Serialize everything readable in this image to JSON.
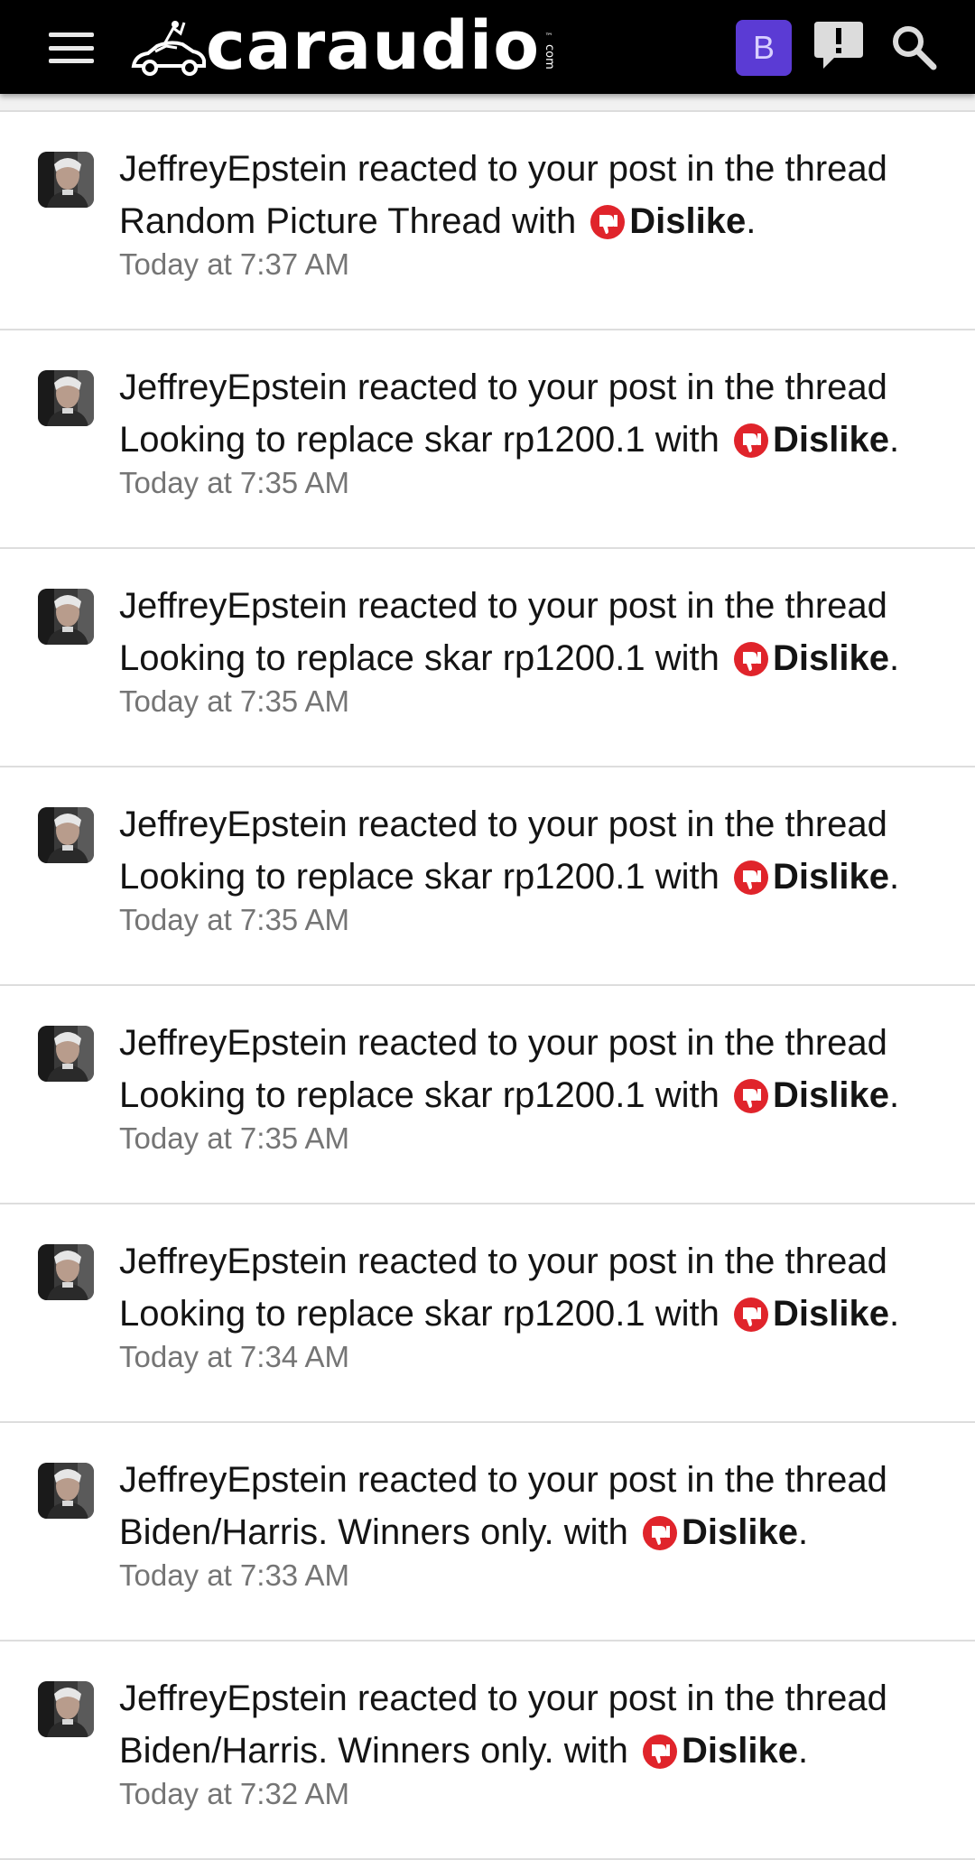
{
  "header": {
    "logo_text": "caraudio",
    "logo_suffix": "com",
    "logo_tm": "™",
    "user_initial": "B",
    "colors": {
      "bar": "#000000",
      "user_badge": "#5b3bd4"
    }
  },
  "icons": {
    "menu": "hamburger-menu-icon",
    "alerts": "alert-bubble-icon",
    "search": "search-icon",
    "reaction": "thumbs-down-icon"
  },
  "notifications": [
    {
      "user": "JeffreyEpstein",
      "action": " reacted to your post in the thread",
      "thread": "Random Picture Thread",
      "with": " with ",
      "reaction": "Dislike",
      "end": ".",
      "time": "Today at 7:37 AM"
    },
    {
      "user": "JeffreyEpstein",
      "action": " reacted to your post in the thread",
      "thread": "Looking to replace skar rp1200.1",
      "with": " with ",
      "reaction": "Dislike",
      "end": ".",
      "time": "Today at 7:35 AM"
    },
    {
      "user": "JeffreyEpstein",
      "action": " reacted to your post in the thread",
      "thread": "Looking to replace skar rp1200.1",
      "with": " with ",
      "reaction": "Dislike",
      "end": ".",
      "time": "Today at 7:35 AM"
    },
    {
      "user": "JeffreyEpstein",
      "action": " reacted to your post in the thread",
      "thread": "Looking to replace skar rp1200.1",
      "with": " with ",
      "reaction": "Dislike",
      "end": ".",
      "time": "Today at 7:35 AM"
    },
    {
      "user": "JeffreyEpstein",
      "action": " reacted to your post in the thread",
      "thread": "Looking to replace skar rp1200.1",
      "with": " with ",
      "reaction": "Dislike",
      "end": ".",
      "time": "Today at 7:35 AM"
    },
    {
      "user": "JeffreyEpstein",
      "action": " reacted to your post in the thread",
      "thread": "Looking to replace skar rp1200.1",
      "with": " with ",
      "reaction": "Dislike",
      "end": ".",
      "time": "Today at 7:34 AM"
    },
    {
      "user": "JeffreyEpstein",
      "action": " reacted to your post in the thread",
      "thread": "Biden/Harris. Winners only.",
      "with": " with ",
      "reaction": "Dislike",
      "end": ".",
      "time": "Today at 7:33 AM"
    },
    {
      "user": "JeffreyEpstein",
      "action": " reacted to your post in the thread",
      "thread": "Biden/Harris. Winners only.",
      "with": " with ",
      "reaction": "Dislike",
      "end": ".",
      "time": "Today at 7:32 AM"
    }
  ]
}
